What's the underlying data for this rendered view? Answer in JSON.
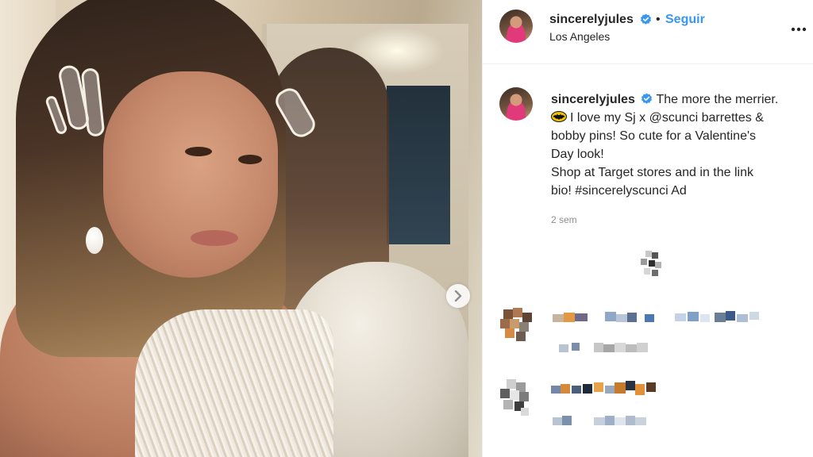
{
  "post": {
    "author": {
      "username": "sincerelyjules",
      "verified": true,
      "follow_label": "Seguir",
      "separator": "•",
      "location": "Los Angeles"
    },
    "more_icon": "more-options-icon",
    "next_icon": "chevron-right-icon",
    "caption": {
      "username": "sincerelyjules",
      "lines": [
        "The more the merrier.",
        "I love my Sj x @scunci barrettes &",
        "bobby pins! So cute for a Valentine's",
        "Day look!",
        "Shop at Target stores and in the link",
        "bio! #sincerelyscunci Ad"
      ],
      "emoji": "batman-logo-emoji"
    },
    "timestamp": "2 sem",
    "loading_icon": "loading-spinner-icon",
    "comments_note": "comments pixelated/censored"
  },
  "colors": {
    "link_blue": "#3897f0",
    "verified_blue": "#3897f0",
    "text": "#262626",
    "muted": "#8e8e8e",
    "divider": "#efefef"
  }
}
